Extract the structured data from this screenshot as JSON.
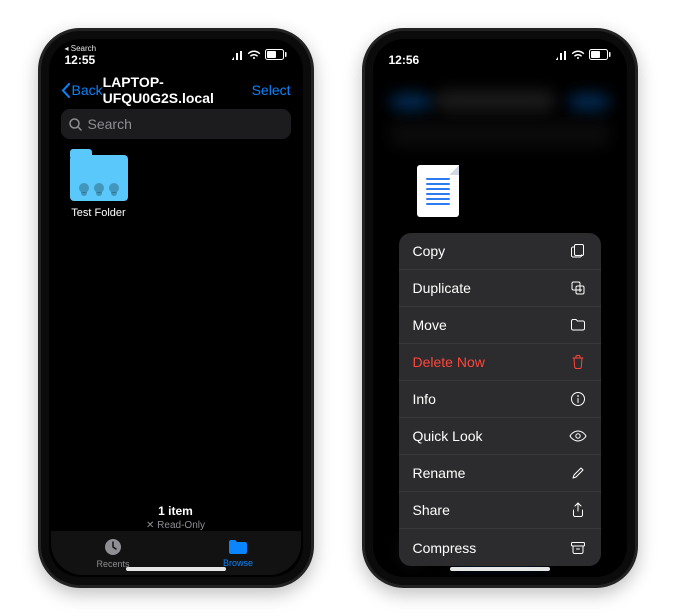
{
  "left_phone": {
    "status": {
      "time": "12:55",
      "return_to": "◂ Search"
    },
    "nav": {
      "back": "Back",
      "title": "LAPTOP-UFQU0G2S.local",
      "select": "Select"
    },
    "search_placeholder": "Search",
    "folder_name": "Test Folder",
    "footer": {
      "count": "1 item",
      "readonly": "✕ Read-Only"
    },
    "tabs": {
      "recents": "Recents",
      "browse": "Browse"
    }
  },
  "right_phone": {
    "status": {
      "time": "12:56"
    },
    "menu": [
      {
        "label": "Copy",
        "icon": "copy-icon",
        "destructive": false
      },
      {
        "label": "Duplicate",
        "icon": "duplicate-icon",
        "destructive": false
      },
      {
        "label": "Move",
        "icon": "folder-icon",
        "destructive": false
      },
      {
        "label": "Delete Now",
        "icon": "trash-icon",
        "destructive": true
      },
      {
        "label": "Info",
        "icon": "info-icon",
        "destructive": false
      },
      {
        "label": "Quick Look",
        "icon": "eye-icon",
        "destructive": false
      },
      {
        "label": "Rename",
        "icon": "pencil-icon",
        "destructive": false
      },
      {
        "label": "Share",
        "icon": "share-icon",
        "destructive": false
      },
      {
        "label": "Compress",
        "icon": "archive-icon",
        "destructive": false
      }
    ]
  }
}
